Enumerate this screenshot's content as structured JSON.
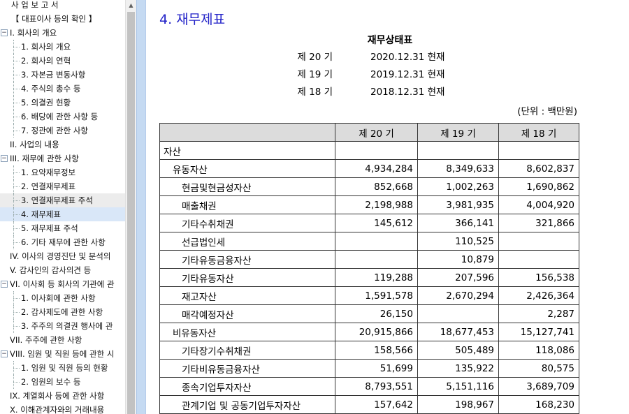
{
  "sidebar": {
    "items": [
      {
        "label": "사 업 보 고 서"
      },
      {
        "label": "【 대표이사 등의 확인 】"
      },
      {
        "label": "I. 회사의 개요"
      },
      {
        "label": "1. 회사의 개요"
      },
      {
        "label": "2. 회사의 연혁"
      },
      {
        "label": "3. 자본금 변동사항"
      },
      {
        "label": "4. 주식의 총수 등"
      },
      {
        "label": "5. 의결권 현황"
      },
      {
        "label": "6. 배당에 관한 사항 등"
      },
      {
        "label": "7. 정관에 관한 사항"
      },
      {
        "label": "II. 사업의 내용"
      },
      {
        "label": "III. 재무에 관한 사항"
      },
      {
        "label": "1. 요약재무정보"
      },
      {
        "label": "2. 연결재무제표"
      },
      {
        "label": "3. 연결재무제표 주석"
      },
      {
        "label": "4. 재무제표"
      },
      {
        "label": "5. 재무제표 주석"
      },
      {
        "label": "6. 기타 재무에 관한 사항"
      },
      {
        "label": "IV. 이사의 경영진단 및 분석의"
      },
      {
        "label": "V. 감사인의 감사의견 등"
      },
      {
        "label": "VI. 이사회 등 회사의 기관에 관"
      },
      {
        "label": "1. 이사회에 관한 사항"
      },
      {
        "label": "2. 감사제도에 관한 사항"
      },
      {
        "label": "3. 주주의 의결권 행사에 관"
      },
      {
        "label": "VII. 주주에 관한 사항"
      },
      {
        "label": "VIII. 임원 및 직원 등에 관한 시"
      },
      {
        "label": "1. 임원 및 직원 등의 현황"
      },
      {
        "label": "2. 임원의 보수 등"
      },
      {
        "label": "IX. 계열회사 등에 관한 사항"
      },
      {
        "label": "X. 이해관계자와의 거래내용"
      }
    ],
    "toggle_symbol": "−"
  },
  "content": {
    "page_title": "4. 재무제표",
    "doc_title": "재무상태표",
    "periods": [
      {
        "label": "제 20 기",
        "date": "2020.12.31 현재"
      },
      {
        "label": "제 19 기",
        "date": "2019.12.31 현재"
      },
      {
        "label": "제 18 기",
        "date": "2018.12.31 현재"
      }
    ],
    "unit_note": "(단위 : 백만원)",
    "table": {
      "headers": [
        "",
        "제 20 기",
        "제 19 기",
        "제 18 기"
      ],
      "rows": [
        {
          "label": "자산",
          "level": 0,
          "values": [
            "",
            "",
            ""
          ]
        },
        {
          "label": "유동자산",
          "level": 1,
          "values": [
            "4,934,284",
            "8,349,633",
            "8,602,837"
          ]
        },
        {
          "label": "현금및현금성자산",
          "level": 2,
          "values": [
            "852,668",
            "1,002,263",
            "1,690,862"
          ]
        },
        {
          "label": "매출채권",
          "level": 2,
          "values": [
            "2,198,988",
            "3,981,935",
            "4,004,920"
          ]
        },
        {
          "label": "기타수취채권",
          "level": 2,
          "values": [
            "145,612",
            "366,141",
            "321,866"
          ]
        },
        {
          "label": "선급법인세",
          "level": 2,
          "values": [
            "",
            "110,525",
            ""
          ]
        },
        {
          "label": "기타유동금융자산",
          "level": 2,
          "values": [
            "",
            "10,879",
            ""
          ]
        },
        {
          "label": "기타유동자산",
          "level": 2,
          "values": [
            "119,288",
            "207,596",
            "156,538"
          ]
        },
        {
          "label": "재고자산",
          "level": 2,
          "values": [
            "1,591,578",
            "2,670,294",
            "2,426,364"
          ]
        },
        {
          "label": "매각예정자산",
          "level": 2,
          "values": [
            "26,150",
            "",
            "2,287"
          ]
        },
        {
          "label": "비유동자산",
          "level": 1,
          "values": [
            "20,915,866",
            "18,677,453",
            "15,127,741"
          ]
        },
        {
          "label": "기타장기수취채권",
          "level": 2,
          "values": [
            "158,566",
            "505,489",
            "118,086"
          ]
        },
        {
          "label": "기타비유동금융자산",
          "level": 2,
          "values": [
            "51,699",
            "135,922",
            "80,575"
          ]
        },
        {
          "label": "종속기업투자자산",
          "level": 2,
          "values": [
            "8,793,551",
            "5,151,116",
            "3,689,709"
          ]
        },
        {
          "label": "관계기업 및 공동기업투자자산",
          "level": 2,
          "values": [
            "157,642",
            "198,967",
            "168,230"
          ]
        },
        {
          "label": "",
          "level": 2,
          "values": [
            "",
            "",
            ""
          ]
        }
      ]
    }
  },
  "colors": {
    "title": "#2323c8",
    "selected": "#d9e7f8",
    "header_bg": "#dcdcdc",
    "divider": "#c5daf2"
  }
}
